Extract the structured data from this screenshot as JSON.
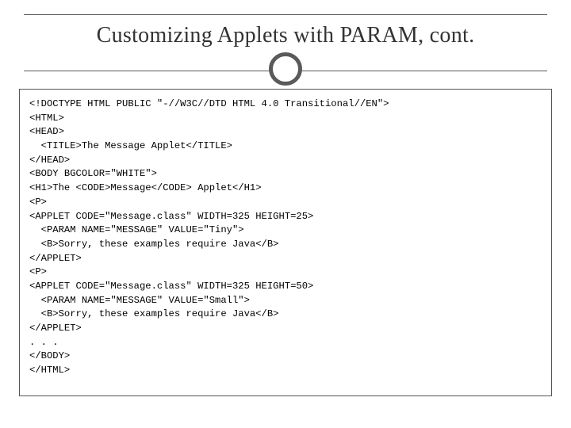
{
  "slide": {
    "title": "Customizing Applets with PARAM, cont."
  },
  "code": {
    "line01": "<!DOCTYPE HTML PUBLIC \"-//W3C//DTD HTML 4.0 Transitional//EN\">",
    "line02": "<HTML>",
    "line03": "<HEAD>",
    "line04": "  <TITLE>The Message Applet</TITLE>",
    "line05": "</HEAD>",
    "line06": "<BODY BGCOLOR=\"WHITE\">",
    "line07": "<H1>The <CODE>Message</CODE> Applet</H1>",
    "line08": "<P>",
    "line09": "<APPLET CODE=\"Message.class\" WIDTH=325 HEIGHT=25>",
    "line10": "  <PARAM NAME=\"MESSAGE\" VALUE=\"Tiny\">",
    "line11": "  <B>Sorry, these examples require Java</B>",
    "line12": "</APPLET>",
    "line13": "<P>",
    "line14": "<APPLET CODE=\"Message.class\" WIDTH=325 HEIGHT=50>",
    "line15": "  <PARAM NAME=\"MESSAGE\" VALUE=\"Small\">",
    "line16": "  <B>Sorry, these examples require Java</B>",
    "line17": "</APPLET>",
    "line18": ". . .",
    "line19": "</BODY>",
    "line20": "</HTML>"
  }
}
